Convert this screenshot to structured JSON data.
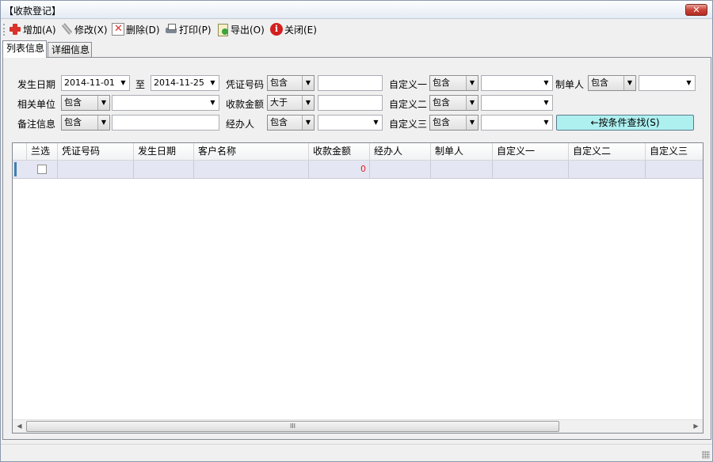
{
  "window": {
    "title": "【收款登记】",
    "close_label": "✕"
  },
  "toolbar": {
    "add": "增加(A)",
    "edit": "修改(X)",
    "delete": "删除(D)",
    "print": "打印(P)",
    "export": "导出(O)",
    "close": "关闭(E)",
    "close_icon_glyph": "i"
  },
  "tabs": [
    "列表信息",
    "详细信息"
  ],
  "filters": {
    "date_label": "发生日期",
    "date_from": "2014-11-01",
    "to_label": "至",
    "date_to": "2014-11-25",
    "voucher_label": "凭证号码",
    "voucher_op": "包含",
    "voucher_value": "",
    "custom1_label": "自定义一",
    "custom1_op": "包含",
    "custom1_value": "",
    "creator_label": "制单人",
    "creator_op": "包含",
    "creator_value": "",
    "unit_label": "相关单位",
    "unit_op": "包含",
    "unit_value": "",
    "amount_label": "收款金额",
    "amount_op": "大于",
    "amount_value": "",
    "custom2_label": "自定义二",
    "custom2_op": "包含",
    "custom2_value": "",
    "note_label": "备注信息",
    "note_op": "包含",
    "note_value": "",
    "handler_label": "经办人",
    "handler_op": "包含",
    "handler_value": "",
    "custom3_label": "自定义三",
    "custom3_op": "包含",
    "custom3_value": "",
    "search_button": "←按条件查找(S)"
  },
  "grid": {
    "columns": [
      "兰选",
      "凭证号码",
      "发生日期",
      "客户名称",
      "收款金额",
      "经办人",
      "制单人",
      "自定义一",
      "自定义二",
      "自定义三"
    ],
    "rows": [
      {
        "checked": false,
        "voucher": "",
        "date": "",
        "customer": "",
        "amount": "0",
        "handler": "",
        "creator": "",
        "custom1": "",
        "custom2": "",
        "custom3": ""
      }
    ],
    "amount_color": "#e02020"
  },
  "scroll": {
    "thumb_glyph": "III"
  },
  "colors": {
    "accent": "#aef0f0",
    "row_selected": "#e4e6f3"
  }
}
